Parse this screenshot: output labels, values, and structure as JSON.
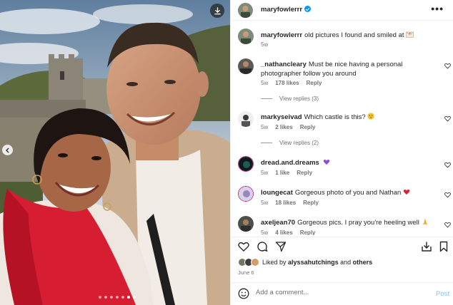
{
  "post": {
    "author": "maryfowlerrr",
    "more": "•••",
    "caption_text": "old pictures I found and smiled at",
    "caption_age": "5w",
    "slides_total": 7,
    "active_slide": 6
  },
  "comments": [
    {
      "username": "_nathancleary",
      "text": "Must be nice having a personal photographer follow you around",
      "age": "5w",
      "likes": "178 likes",
      "reply": "Reply",
      "view_replies": "View replies (3)"
    },
    {
      "username": "markyseivad",
      "text": "Which castle is this?",
      "age": "5w",
      "likes": "2 likes",
      "reply": "Reply",
      "view_replies": "View replies (2)"
    },
    {
      "username": "dread.and.dreams",
      "text": "",
      "age": "5w",
      "likes": "1 like",
      "reply": "Reply"
    },
    {
      "username": "loungecat",
      "text": "Gorgeous photo of you and Nathan",
      "age": "5w",
      "likes": "18 likes",
      "reply": "Reply"
    },
    {
      "username": "axeljean70",
      "text": "Gorgeous pics. I pray you're heeling well",
      "age": "5w",
      "likes": "4 likes",
      "reply": "Reply"
    }
  ],
  "likes": {
    "prefix": "Liked by",
    "user": "alyssahutchings",
    "and": "and",
    "others": "others"
  },
  "date": "June 6",
  "add_comment": {
    "placeholder": "Add a comment...",
    "post_label": "Post"
  },
  "colors": {
    "verified": "#0095f6",
    "post_button": "#85c6ef",
    "secondary_text": "#737373"
  },
  "icons": [
    "download-icon",
    "chevron-left-icon",
    "verified-badge-icon",
    "more-icon",
    "heart-icon",
    "comment-icon",
    "share-icon",
    "save-icon",
    "bookmark-icon",
    "emoji-icon"
  ]
}
